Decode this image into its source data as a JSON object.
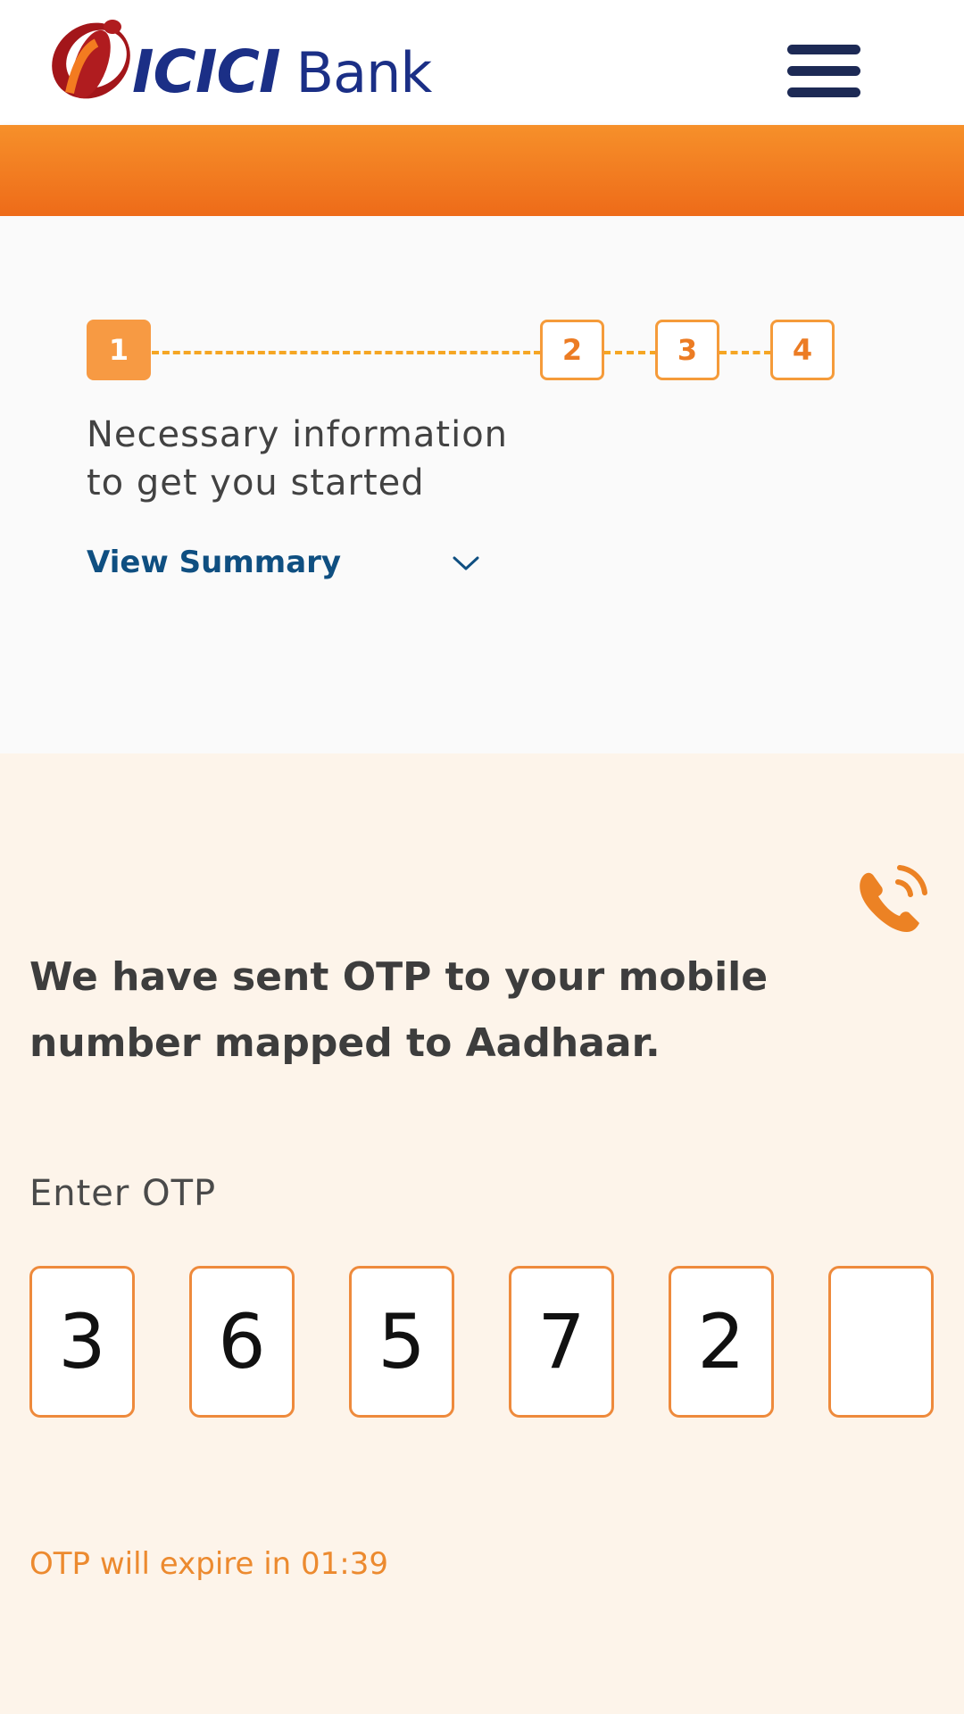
{
  "header": {
    "logo_text": "ICICI",
    "logo_bank": "Bank",
    "menu_icon": "hamburger-menu-icon"
  },
  "colors": {
    "brand_blue": "#1b2f86",
    "brand_orange": "#ee6b19",
    "accent_orange": "#f79a43",
    "link_blue": "#0f4f81",
    "logo_red": "#a3161a"
  },
  "stepper": {
    "steps": [
      "1",
      "2",
      "3",
      "4"
    ],
    "active_step": "1",
    "description_line1": "Necessary information",
    "description_line2": "to get you started",
    "view_summary_label": "View Summary",
    "view_summary_icon": "chevron-down-icon"
  },
  "otp": {
    "call_icon": "phone-call-icon",
    "heading": "We have sent OTP to your mobile number mapped to Aadhaar.",
    "label": "Enter OTP",
    "digits": [
      "3",
      "6",
      "5",
      "7",
      "2",
      ""
    ],
    "expiry_text": "OTP will expire in",
    "expiry_time": "01:39"
  }
}
